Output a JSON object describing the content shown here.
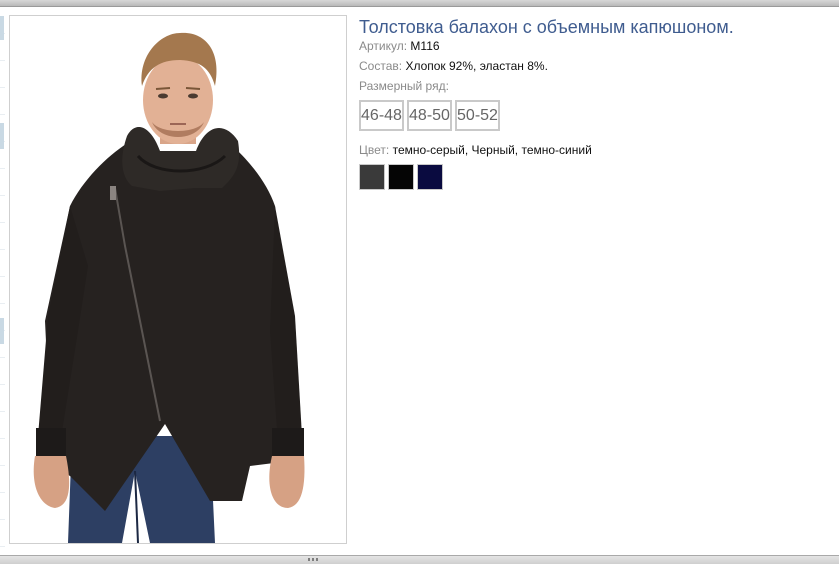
{
  "product": {
    "title": "Толстовка балахон с объемным капюшоном.",
    "article_label": "Артикул:",
    "article_value": "M116",
    "composition_label": "Состав:",
    "composition_value": "Хлопок 92%, эластан 8%.",
    "size_range_label": "Размерный ряд:",
    "sizes": [
      "46-48",
      "48-50",
      "50-52"
    ],
    "color_label": "Цвет:",
    "color_value": "темно-серый, Черный, темно-синий",
    "swatches": [
      "#3a3a3a",
      "#050505",
      "#0a0b40"
    ]
  }
}
